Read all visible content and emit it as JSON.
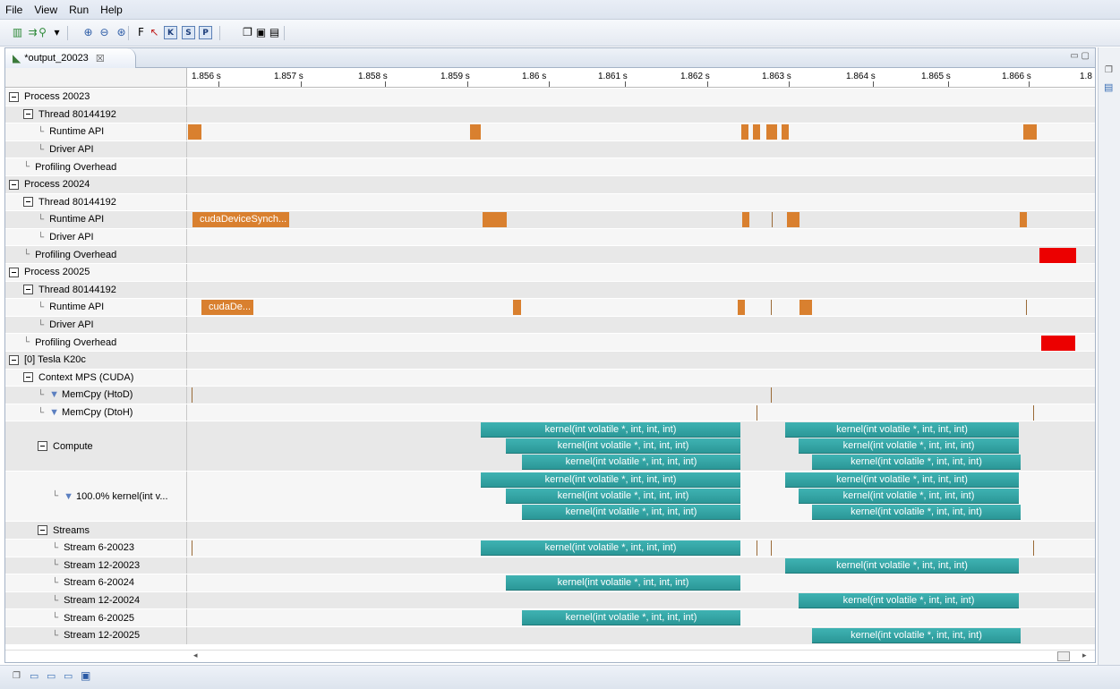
{
  "menu": [
    "File",
    "View",
    "Run",
    "Help"
  ],
  "toolbar_icons": [
    {
      "name": "new-session-icon",
      "glyph": "▥"
    },
    {
      "name": "import-icon",
      "glyph": "⇉"
    },
    {
      "name": "search-icon",
      "glyph": "⚲"
    },
    {
      "name": "dropdown-icon",
      "glyph": "▾"
    },
    {
      "name": "zoom-in-icon",
      "glyph": "⊕"
    },
    {
      "name": "zoom-out-icon",
      "glyph": "⊖"
    },
    {
      "name": "zoom-fit-icon",
      "glyph": "⊛"
    },
    {
      "name": "filter-f-icon",
      "glyph": "F"
    },
    {
      "name": "arrow-icon",
      "glyph": "↖"
    },
    {
      "name": "kernel-toggle-icon",
      "glyph": "K"
    },
    {
      "name": "stream-toggle-icon",
      "glyph": "S"
    },
    {
      "name": "process-toggle-icon",
      "glyph": "P"
    },
    {
      "name": "new-window-icon",
      "glyph": "❐"
    },
    {
      "name": "save-icon",
      "glyph": "▣"
    },
    {
      "name": "save-all-icon",
      "glyph": "▤"
    }
  ],
  "tab": {
    "title": "*output_20023",
    "close": "☒"
  },
  "timeline": {
    "ticks": [
      "1.856 s",
      "1.857 s",
      "1.858 s",
      "1.859 s",
      "1.86 s",
      "1.861 s",
      "1.862 s",
      "1.863 s",
      "1.864 s",
      "1.865 s",
      "1.866 s",
      "1.8"
    ]
  },
  "rows": [
    {
      "label": "Process 20023",
      "indent": 0,
      "toggle": true
    },
    {
      "label": "Thread 80144192",
      "indent": 1,
      "toggle": true
    },
    {
      "label": "Runtime API",
      "indent": 2,
      "branch": true
    },
    {
      "label": "Driver API",
      "indent": 2,
      "branch": true
    },
    {
      "label": "Profiling Overhead",
      "indent": 1,
      "branch": true
    },
    {
      "label": "Process 20024",
      "indent": 0,
      "toggle": true
    },
    {
      "label": "Thread 80144192",
      "indent": 1,
      "toggle": true
    },
    {
      "label": "Runtime API",
      "indent": 2,
      "branch": true
    },
    {
      "label": "Driver API",
      "indent": 2,
      "branch": true
    },
    {
      "label": "Profiling Overhead",
      "indent": 1,
      "branch": true
    },
    {
      "label": "Process 20025",
      "indent": 0,
      "toggle": true
    },
    {
      "label": "Thread 80144192",
      "indent": 1,
      "toggle": true
    },
    {
      "label": "Runtime API",
      "indent": 2,
      "branch": true
    },
    {
      "label": "Driver API",
      "indent": 2,
      "branch": true
    },
    {
      "label": "Profiling Overhead",
      "indent": 1,
      "branch": true
    },
    {
      "label": "[0] Tesla K20c",
      "indent": 0,
      "toggle": true
    },
    {
      "label": "Context MPS (CUDA)",
      "indent": 1,
      "toggle": true
    },
    {
      "label": "MemCpy (HtoD)",
      "indent": 2,
      "branch": true,
      "funnel": true
    },
    {
      "label": "MemCpy (DtoH)",
      "indent": 2,
      "branch": true,
      "funnel": true
    },
    {
      "label": "Compute",
      "indent": 2,
      "toggle": true,
      "tall": true
    },
    {
      "label": "100.0% kernel(int v...",
      "indent": 3,
      "branch": true,
      "funnel": true,
      "tall": true
    },
    {
      "label": "Streams",
      "indent": 2,
      "toggle": true
    },
    {
      "label": "Stream 6-20023",
      "indent": 3,
      "branch": true
    },
    {
      "label": "Stream 12-20023",
      "indent": 3,
      "branch": true
    },
    {
      "label": "Stream 6-20024",
      "indent": 3,
      "branch": true
    },
    {
      "label": "Stream 12-20024",
      "indent": 3,
      "branch": true
    },
    {
      "label": "Stream 6-20025",
      "indent": 3,
      "branch": true
    },
    {
      "label": "Stream 12-20025",
      "indent": 3,
      "branch": true
    }
  ],
  "events": {
    "runtime_label_a": "cudaDeviceSynch...",
    "runtime_label_b": "cudaDe...",
    "kernel_label": "kernel(int volatile *, int, int, int)"
  },
  "colors": {
    "runtime": "#d9802f",
    "overhead": "#ec0000",
    "kernel": "#2fa3a3"
  },
  "bottom_icons": [
    "restore-icon",
    "console-icon",
    "properties-icon",
    "details-icon",
    "settings-icon"
  ],
  "right_icons": [
    "restore-icon",
    "outline-icon"
  ]
}
